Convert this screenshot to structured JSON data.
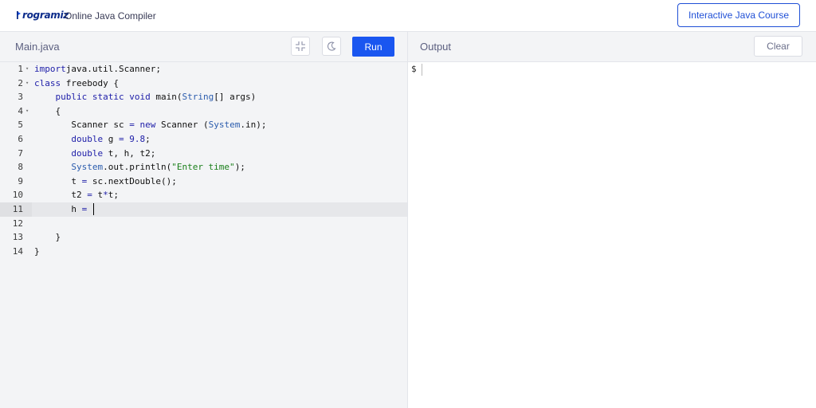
{
  "header": {
    "logo_text": "rogramiz",
    "app_title": "Online Java Compiler",
    "course_button": "Interactive Java Course"
  },
  "editor": {
    "file_tab": "Main.java",
    "run_label": "Run",
    "shrink_icon": "shrink-icon",
    "theme_icon": "moon-icon",
    "active_line": 11,
    "lines": [
      {
        "n": "1",
        "fold": true,
        "tokens": [
          [
            "kw",
            "import"
          ],
          [
            "",
            "java.util.Scanner;"
          ]
        ]
      },
      {
        "n": "2",
        "fold": true,
        "tokens": [
          [
            "kw",
            "class"
          ],
          [
            "",
            " freebody {"
          ]
        ]
      },
      {
        "n": "3",
        "fold": false,
        "tokens": [
          [
            "",
            "    "
          ],
          [
            "kw",
            "public static void"
          ],
          [
            "",
            " main("
          ],
          [
            "ty",
            "String"
          ],
          [
            "",
            "[] args)"
          ]
        ]
      },
      {
        "n": "4",
        "fold": true,
        "tokens": [
          [
            "",
            "    {"
          ]
        ]
      },
      {
        "n": "5",
        "fold": false,
        "tokens": [
          [
            "",
            "       Scanner sc "
          ],
          [
            "kw",
            "="
          ],
          [
            "",
            " "
          ],
          [
            "kw",
            "new"
          ],
          [
            "",
            " Scanner ("
          ],
          [
            "ty",
            "System"
          ],
          [
            "",
            ".in);"
          ]
        ]
      },
      {
        "n": "6",
        "fold": false,
        "tokens": [
          [
            "",
            "       "
          ],
          [
            "kw",
            "double"
          ],
          [
            "",
            " g "
          ],
          [
            "kw",
            "="
          ],
          [
            "",
            " "
          ],
          [
            "nm",
            "9.8"
          ],
          [
            "",
            ";"
          ]
        ]
      },
      {
        "n": "7",
        "fold": false,
        "tokens": [
          [
            "",
            "       "
          ],
          [
            "kw",
            "double"
          ],
          [
            "",
            " t, h, t2;"
          ]
        ]
      },
      {
        "n": "8",
        "fold": false,
        "tokens": [
          [
            "",
            "       "
          ],
          [
            "ty",
            "System"
          ],
          [
            "",
            ".out.println("
          ],
          [
            "st",
            "\"Enter time\""
          ],
          [
            "",
            ");"
          ]
        ]
      },
      {
        "n": "9",
        "fold": false,
        "tokens": [
          [
            "",
            "       t "
          ],
          [
            "kw",
            "="
          ],
          [
            "",
            " sc.nextDouble();"
          ]
        ]
      },
      {
        "n": "10",
        "fold": false,
        "tokens": [
          [
            "",
            "       t2 "
          ],
          [
            "kw",
            "="
          ],
          [
            "",
            " t"
          ],
          [
            "kw",
            "*"
          ],
          [
            "",
            "t;"
          ]
        ]
      },
      {
        "n": "11",
        "fold": false,
        "tokens": [
          [
            "",
            "       h "
          ],
          [
            "kw",
            "="
          ],
          [
            "",
            " "
          ]
        ]
      },
      {
        "n": "12",
        "fold": false,
        "tokens": []
      },
      {
        "n": "13",
        "fold": false,
        "tokens": [
          [
            "",
            "    }"
          ]
        ]
      },
      {
        "n": "14",
        "fold": false,
        "tokens": [
          [
            "",
            "}"
          ]
        ]
      }
    ]
  },
  "output": {
    "label": "Output",
    "clear_label": "Clear",
    "prompt": "$"
  },
  "colors": {
    "accent": "#1a56f0",
    "keyword": "#1d1da8",
    "string": "#1a7f1a",
    "type": "#2b5cad"
  }
}
